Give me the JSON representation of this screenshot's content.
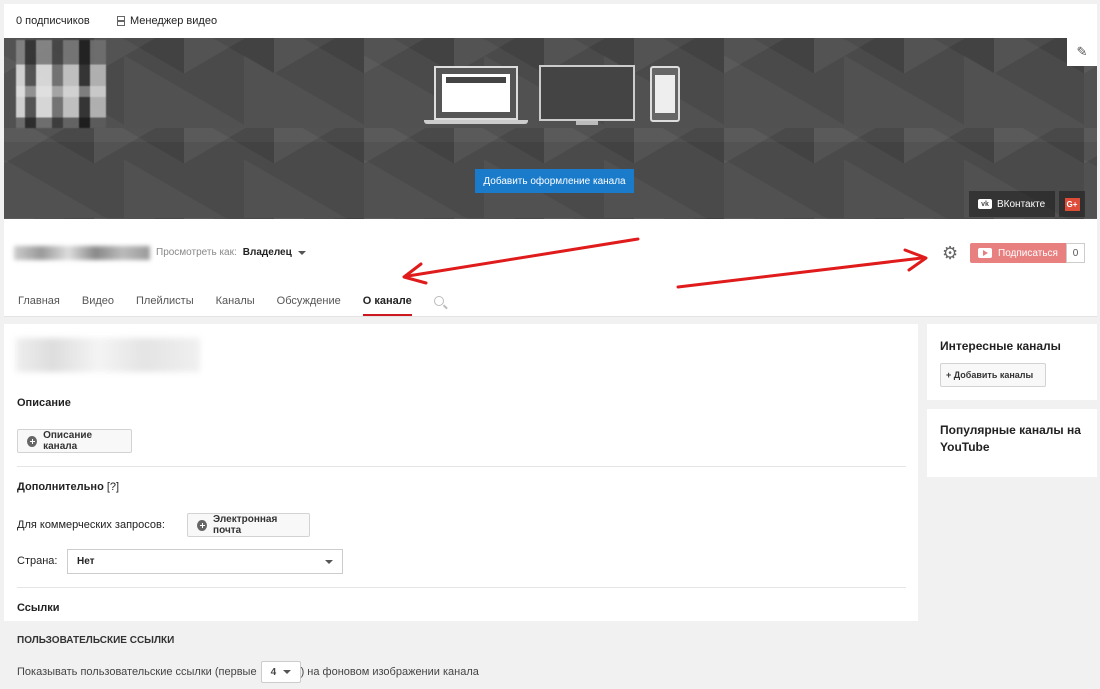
{
  "topbar": {
    "subscribers": "0 подписчиков",
    "video_manager": "Менеджер видео"
  },
  "banner": {
    "add_design_button": "Добавить оформление канала",
    "social_vk": "ВКонтакте",
    "social_vk_icon": "vk",
    "social_gplus_icon": "G+"
  },
  "channel": {
    "view_as_label": "Просмотреть как:",
    "view_as_value": "Владелец",
    "subscribe_button": "Подписаться",
    "subscriber_count": "0",
    "tabs": [
      {
        "label": "Главная"
      },
      {
        "label": "Видео"
      },
      {
        "label": "Плейлисты"
      },
      {
        "label": "Каналы"
      },
      {
        "label": "Обсуждение"
      },
      {
        "label": "О канале",
        "active": true
      }
    ]
  },
  "about": {
    "description_title": "Описание",
    "description_button": "Описание канала",
    "additional_title": "Дополнительно",
    "additional_help": "[?]",
    "business_label": "Для коммерческих запросов:",
    "email_button": "Электронная почта",
    "country_label": "Страна:",
    "country_value": "Нет",
    "links_title": "Ссылки",
    "custom_links_title": "ПОЛЬЗОВАТЕЛЬСКИЕ ССЫЛКИ",
    "show_links_prefix": "Показывать пользовательские ссылки (первые",
    "show_links_count": "4",
    "show_links_suffix": ") на фоновом изображении канала"
  },
  "sidebar": {
    "featured_title": "Интересные каналы",
    "add_channels_button": "+ Добавить каналы",
    "popular_title": "Популярные каналы на YouTube"
  },
  "colors": {
    "accent_blue": "#1a7bcb",
    "subscribe_red": "#e88080",
    "active_tab": "#cc181e",
    "annotation_arrow": "#e01b1b"
  }
}
